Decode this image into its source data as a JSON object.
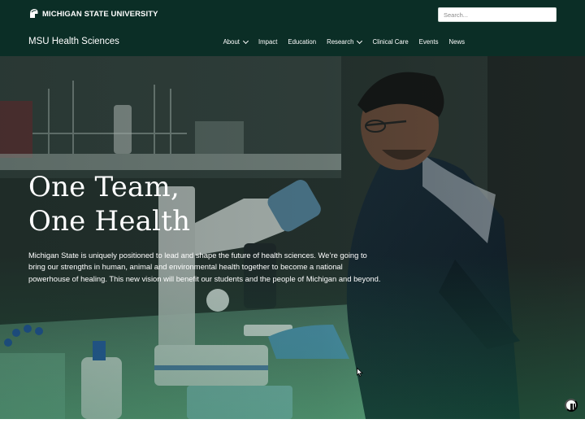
{
  "header": {
    "university_name": "MICHIGAN STATE UNIVERSITY",
    "logo_icon": "spartan-helmet-icon",
    "search": {
      "placeholder": "Search...",
      "value": ""
    }
  },
  "nav": {
    "site_title": "MSU Health Sciences",
    "items": [
      {
        "label": "About",
        "has_dropdown": true
      },
      {
        "label": "Impact",
        "has_dropdown": false
      },
      {
        "label": "Education",
        "has_dropdown": false
      },
      {
        "label": "Research",
        "has_dropdown": true
      },
      {
        "label": "Clinical Care",
        "has_dropdown": false
      },
      {
        "label": "Events",
        "has_dropdown": false
      },
      {
        "label": "News",
        "has_dropdown": false
      }
    ]
  },
  "hero": {
    "headline_line1": "One Team,",
    "headline_line2": "One Health",
    "body": "Michigan State is uniquely positioned to lead and shape the future of health sciences. We’re going to bring our strengths in human, animal and environmental health together to become a national powerhouse of healing. This new vision will benefit our students and the people of Michigan and beyond.",
    "background": "researcher-at-microscope-photo",
    "pause_icon": "pause-icon"
  },
  "colors": {
    "brand_dark_green": "#0b2e26",
    "hero_green_tint": "#1c5a41",
    "text_white": "#ffffff"
  }
}
